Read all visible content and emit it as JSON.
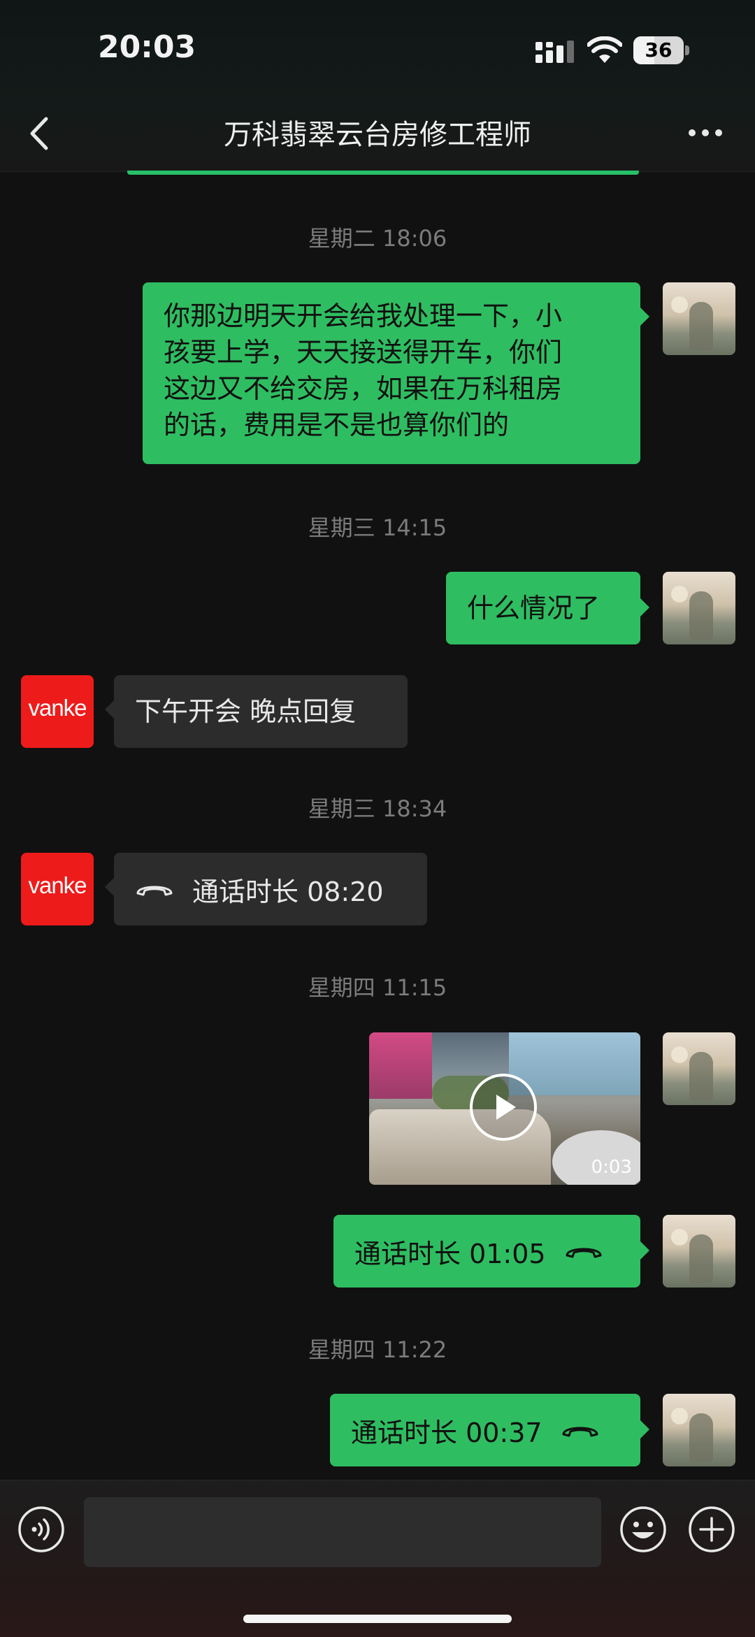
{
  "status_bar": {
    "time": "20:03",
    "battery": "36"
  },
  "header": {
    "title": "万科翡翠云台房修工程师"
  },
  "messages": {
    "ts1": "星期二 18:06",
    "m1_lines": [
      "你那边明天开会给我处理一下，小",
      "孩要上学，天天接送得开车，你们",
      "这边又不给交房，如果在万科租房",
      "的话，费用是不是也算你们的"
    ],
    "ts2": "星期三 14:15",
    "m2": "什么情况了",
    "m3": "下午开会 晚点回复",
    "ts3": "星期三 18:34",
    "m4": "通话时长 08:20",
    "ts4": "星期四 11:15",
    "video_duration": "0:03",
    "m5": "通话时长 01:05",
    "ts5": "星期四 11:22",
    "m6": "通话时长 00:37"
  },
  "contact_avatar_text": "vanke",
  "icons": {
    "back": "chevron-left-icon",
    "more": "more-dots-icon",
    "call": "phone-hangup-icon",
    "play": "play-icon",
    "voice": "voice-icon",
    "emoji": "emoji-icon",
    "plus": "plus-icon"
  },
  "colors": {
    "bubble_green": "#2fbd61",
    "bubble_grey": "#2c2c2c",
    "vanke_red": "#ee1b1b",
    "background": "#111111"
  }
}
